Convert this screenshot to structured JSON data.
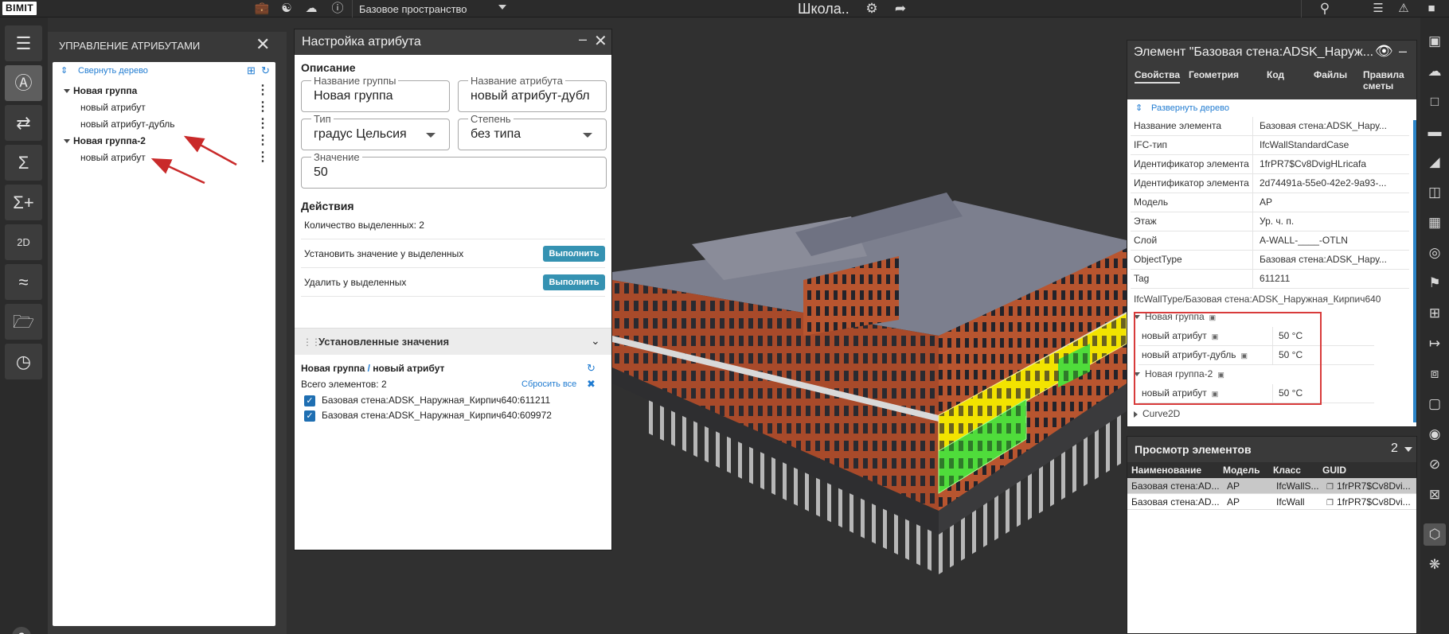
{
  "topbar": {
    "logo": "BIMIT",
    "workspace": "Базовое пространство",
    "project_title": "Школа..",
    "icons": [
      "briefcase-icon",
      "users-icon",
      "chat-icon",
      "help-icon",
      "settings-icon",
      "share-icon",
      "search-icon",
      "list-icon",
      "notifications-icon",
      "account-icon"
    ]
  },
  "left_toolbar": {
    "buttons": [
      "tree-icon",
      "attribute-icon",
      "shuffle-icon",
      "sum-icon",
      "sum-plus-icon",
      "2d-icon",
      "chart-icon",
      "folder-icon",
      "gauge-icon"
    ],
    "active_index": 1,
    "twod_label": "2D",
    "help": "?"
  },
  "attr_panel": {
    "title": "УПРАВЛЕНИЕ АТРИБУТАМИ",
    "collapse_label": "Свернуть дерево",
    "tree": [
      {
        "label": "Новая группа",
        "level": 0,
        "bold": true
      },
      {
        "label": "новый атрибут",
        "level": 1,
        "bold": false
      },
      {
        "label": "новый атрибут-дубль",
        "level": 1,
        "bold": false
      },
      {
        "label": "Новая группа-2",
        "level": 0,
        "bold": true
      },
      {
        "label": "новый атрибут",
        "level": 1,
        "bold": false
      }
    ]
  },
  "dialog": {
    "title": "Настройка атрибута",
    "description_title": "Описание",
    "group_name_label": "Название группы",
    "group_name_value": "Новая группа",
    "attr_name_label": "Название атрибута",
    "attr_name_value": "новый атрибут-дубл",
    "type_label": "Тип",
    "type_value": "градус Цельсия",
    "degree_label": "Степень",
    "degree_value": "без типа",
    "value_label": "Значение",
    "value_value": "50",
    "actions_title": "Действия",
    "selected_count": "Количество выделенных: 2",
    "set_value_label": "Установить значение у выделенных",
    "delete_label": "Удалить у выделенных",
    "run_label": "Выполнить",
    "set_values_title": "Установленные значения",
    "path_group": "Новая группа",
    "path_sep": " / ",
    "path_attr": "новый атрибут",
    "total": "Всего элементов: 2",
    "reset_all": "Сбросить все",
    "elements": [
      "Базовая стена:ADSK_Наружная_Кирпич640:611211",
      "Базовая стена:ADSK_Наружная_Кирпич640:609972"
    ]
  },
  "element_panel": {
    "title": "Элемент \"Базовая стена:ADSK_Наруж...",
    "tabs": [
      "Свойства",
      "Геометрия",
      "Код",
      "Файлы",
      "Правила",
      "сметы"
    ],
    "expand_label": "Развернуть дерево",
    "props": [
      {
        "k": "Название элемента",
        "v": "Базовая стена:ADSK_Нару..."
      },
      {
        "k": "IFC-тип",
        "v": "IfcWallStandardCase"
      },
      {
        "k": "Идентификатор элемента ...",
        "v": "1frPR7$Cv8DvigHLricafa"
      },
      {
        "k": "Идентификатор элемента ...",
        "v": "2d74491a-55e0-42e2-9a93-..."
      },
      {
        "k": "Модель",
        "v": "АР"
      },
      {
        "k": "Этаж",
        "v": "Ур. ч. п."
      },
      {
        "k": "Слой",
        "v": "A-WALL-____-OTLN"
      },
      {
        "k": "ObjectType",
        "v": "Базовая стена:ADSK_Нару..."
      },
      {
        "k": "Tag",
        "v": "611211"
      }
    ],
    "wide_row": "IfcWallType/Базовая стена:ADSK_Наружная_Кирпич640",
    "group1": "Новая группа",
    "group1_attrs": [
      {
        "k": "новый атрибут",
        "v": "50 °C"
      },
      {
        "k": "новый атрибут-дубль",
        "v": "50 °C"
      }
    ],
    "group2": "Новая группа-2",
    "group2_attrs": [
      {
        "k": "новый атрибут",
        "v": "50 °C"
      }
    ],
    "curve": "Curve2D"
  },
  "view_panel": {
    "title": "Просмотр элементов",
    "count": "2",
    "headers": [
      "Наименование",
      "Модель",
      "Класс",
      "GUID"
    ],
    "rows": [
      {
        "name": "Базовая стена:AD...",
        "model": "АР",
        "cls": "IfcWallS...",
        "guid": "1frPR7$Cv8Dvi...",
        "selected": true
      },
      {
        "name": "Базовая стена:AD...",
        "model": "АР",
        "cls": "IfcWall",
        "guid": "1frPR7$Cv8Dvi...",
        "selected": false
      }
    ]
  },
  "colors": {
    "accent": "#1f7bd1",
    "run_button": "#3592b2",
    "highlight_red": "#d83b3b",
    "selected_yellow": "#f2e300",
    "selected_green": "#36d436",
    "brick": "#b4502e"
  }
}
